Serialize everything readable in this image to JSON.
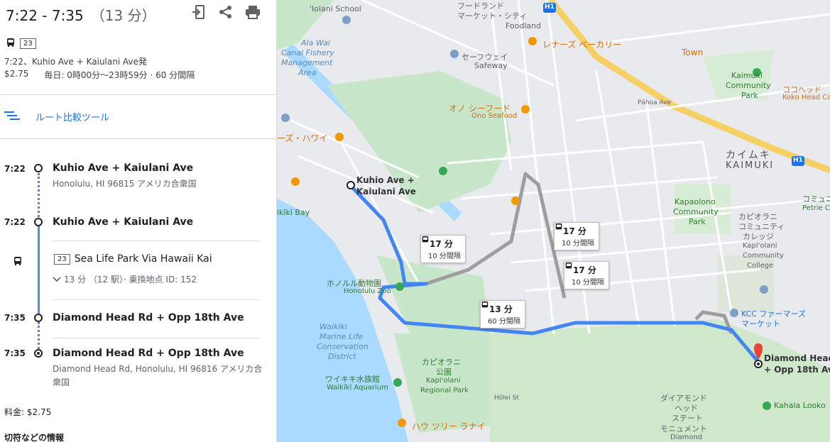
{
  "header": {
    "time_range": "7:22 - 7:35",
    "duration": "（13 分）",
    "icons": [
      "send-to-phone-icon",
      "share-icon",
      "print-icon"
    ]
  },
  "summary": {
    "route_badge": "23",
    "departure": "7:22、Kuhio Ave + Kaiulani Ave発",
    "fare": "$2.75",
    "schedule": "毎日: 0時00分～23時59分 · 60 分間隔"
  },
  "compare": {
    "label": "ルート比較ツール"
  },
  "steps": {
    "s1": {
      "time": "7:22",
      "name": "Kuhio Ave + Kaiulani Ave",
      "address": "Honolulu, HI 96815 アメリカ合衆国"
    },
    "s2": {
      "time": "7:22",
      "name": "Kuhio Ave + Kaiulani Ave"
    },
    "bus": {
      "badge": "23",
      "name": "Sea Life Park Via Hawaii Kai",
      "meta": "13 分 （12 駅）· 乗換地点 ID: 152"
    },
    "s3": {
      "time": "7:35",
      "name": "Diamond Head Rd + Opp 18th Ave"
    },
    "s4": {
      "time": "7:35",
      "name": "Diamond Head Rd + Opp 18th Ave",
      "address": "Diamond Head Rd, Honolulu, HI 96816 アメリカ合衆国"
    }
  },
  "footer": {
    "fare_total": "料金: $2.75",
    "ticket_info": "切符などの情報"
  },
  "map": {
    "start_label_1": "Kuhio Ave +",
    "start_label_2": "Kaiulani Ave",
    "end_label_1": "Diamond Head",
    "end_label_2": "+ Opp 18th Ave",
    "boxes": [
      {
        "time": "17 分",
        "interval": "10 分間隔"
      },
      {
        "time": "17 分",
        "interval": "10 分間隔"
      },
      {
        "time": "17 分",
        "interval": "10 分間隔"
      },
      {
        "time": "13 分",
        "interval": "60 分間隔"
      }
    ],
    "labels": {
      "iolani": "'Iolani School",
      "foodland_jp": "フードランド",
      "market_city": "マーケット・シティ",
      "foodland": "Foodland",
      "leonards": "レナーズ ベーカリー",
      "town": "Town",
      "kaimuki_cp": "Kaimukī",
      "kaimuki_cp2": "Community",
      "kaimuki_cp3": "Park",
      "koko_jp": "ココヘッド",
      "koko": "Koko Head Ca",
      "ala_wai_1": "Ala Wai",
      "ala_wai_2": "Canal Fishery",
      "ala_wai_3": "Management",
      "ala_wai_4": "Area",
      "safeway_jp": "セーフウェイ",
      "safeway": "Safeway",
      "ono_jp": "オノ シーフード",
      "ono": "Ono Seafood",
      "hawaii_jp": "ーズ・ハワイ",
      "kaimuki_jp": "カイムキ",
      "kaimuki": "KAIMUKI",
      "kapaolono_1": "Kapaolono",
      "kapaolono_2": "Community",
      "kapaolono_3": "Park",
      "kcc_1": "カピオラニ",
      "kcc_2": "コミュニティ",
      "kcc_3": "カレッジ",
      "kcc_4": "Kapi'olani",
      "kcc_5": "Community",
      "kcc_6": "College",
      "bay": "ikīkī Bay",
      "zoo_jp": "ホノルル動物園",
      "zoo": "Honolulu Zoo",
      "marine_1": "Waikiki",
      "marine_2": "Marine Life",
      "marine_3": "Conservation",
      "marine_4": "District",
      "park_jp1": "カピオラニ",
      "park_jp2": "公園",
      "park_1": "Kapi'olani",
      "park_2": "Regional Park",
      "aquarium_jp": "ワイキキ水族館",
      "aquarium": "Waikīkī Aquarium",
      "hau": "ハウ ツリー ラナイ",
      "kcc_market_1": "KCC ファーマーズ",
      "kcc_market_2": "マーケット",
      "diamond_1": "ダイアモンド",
      "diamond_2": "ヘッド",
      "diamond_3": "ステート",
      "diamond_4": "モニュメント",
      "diamond_5": "Diamond",
      "kahala": "Kahala Looko",
      "commu": "コミュニ",
      "petrie": "Petrie C",
      "h1": "H1",
      "street_pahoa": "Pāhoa Ave",
      "street_hoolei": "Hōlei St"
    }
  }
}
